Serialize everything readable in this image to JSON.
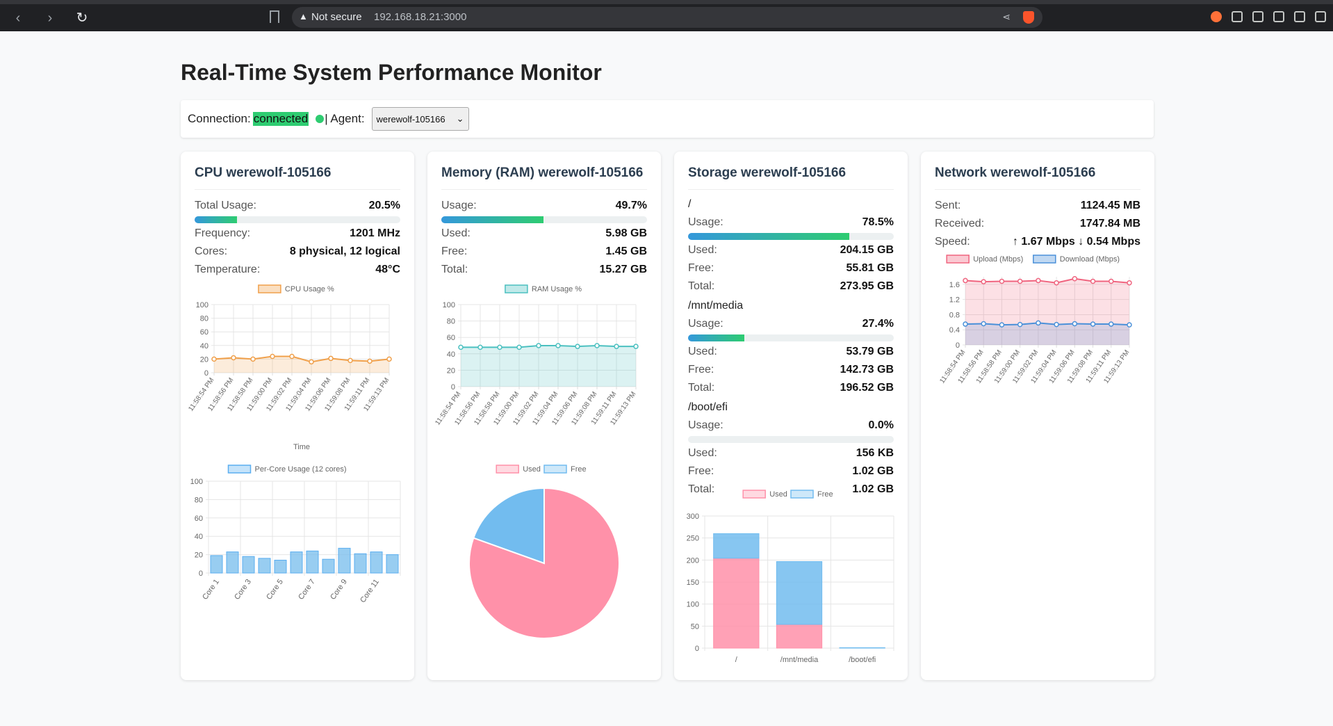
{
  "browser": {
    "security_label": "Not secure",
    "url": "192.168.18.21:3000"
  },
  "page": {
    "title": "Real-Time System Performance Monitor",
    "connection_label": "Connection:",
    "connection_state": "connected",
    "agent_label": "| Agent:",
    "agent_selected": "werewolf-105166",
    "status_color": "#2ecc71"
  },
  "cpu": {
    "title": "CPU werewolf-105166",
    "total_usage_label": "Total Usage:",
    "total_usage": "20.5%",
    "total_usage_value": 20.5,
    "frequency_label": "Frequency:",
    "frequency": "1201 MHz",
    "cores_label": "Cores:",
    "cores": "8 physical, 12 logical",
    "temperature_label": "Temperature:",
    "temperature": "48°C"
  },
  "memory": {
    "title": "Memory (RAM) werewolf-105166",
    "usage_label": "Usage:",
    "usage": "49.7%",
    "usage_value": 49.7,
    "used_label": "Used:",
    "used": "5.98 GB",
    "free_label": "Free:",
    "free": "1.45 GB",
    "total_label": "Total:",
    "total": "15.27 GB"
  },
  "storage": {
    "title": "Storage werewolf-105166",
    "mounts": [
      {
        "name": "/",
        "usage_label": "Usage:",
        "usage": "78.5%",
        "usage_value": 78.5,
        "used_label": "Used:",
        "used": "204.15 GB",
        "free_label": "Free:",
        "free": "55.81 GB",
        "total_label": "Total:",
        "total": "273.95 GB"
      },
      {
        "name": "/mnt/media",
        "usage_label": "Usage:",
        "usage": "27.4%",
        "usage_value": 27.4,
        "used_label": "Used:",
        "used": "53.79 GB",
        "free_label": "Free:",
        "free": "142.73 GB",
        "total_label": "Total:",
        "total": "196.52 GB"
      },
      {
        "name": "/boot/efi",
        "usage_label": "Usage:",
        "usage": "0.0%",
        "usage_value": 0.0,
        "used_label": "Used:",
        "used": "156 KB",
        "free_label": "Free:",
        "free": "1.02 GB",
        "total_label": "Total:",
        "total": "1.02 GB"
      }
    ]
  },
  "network": {
    "title": "Network werewolf-105166",
    "sent_label": "Sent:",
    "sent": "1124.45 MB",
    "received_label": "Received:",
    "received": "1747.84 MB",
    "speed_label": "Speed:",
    "speed": "↑ 1.67 Mbps ↓ 0.54 Mbps"
  },
  "chart_data": [
    {
      "id": "cpu_line",
      "type": "line",
      "legend": "CPU Usage %",
      "xlabel": "Time",
      "x": [
        "11:58:54 PM",
        "11:58:56 PM",
        "11:58:58 PM",
        "11:59:00 PM",
        "11:59:02 PM",
        "11:59:04 PM",
        "11:59:06 PM",
        "11:59:08 PM",
        "11:59:11 PM",
        "11:59:13 PM"
      ],
      "values": [
        20,
        22,
        20,
        24,
        24,
        16,
        21,
        18,
        17,
        20
      ],
      "ylim": [
        0,
        100
      ],
      "yticks": [
        0,
        20,
        40,
        60,
        80,
        100
      ],
      "color": "#f0a04b"
    },
    {
      "id": "cpu_cores",
      "type": "bar",
      "legend": "Per-Core Usage (12 cores)",
      "categories": [
        "Core 1",
        "Core 2",
        "Core 3",
        "Core 4",
        "Core 5",
        "Core 6",
        "Core 7",
        "Core 8",
        "Core 9",
        "Core 10",
        "Core 11",
        "Core 12"
      ],
      "shown_tick_labels": [
        "Core 1",
        "Core 3",
        "Core 5",
        "Core 7",
        "Core 9",
        "Core 11"
      ],
      "values": [
        19,
        23,
        18,
        16,
        14,
        23,
        24,
        15,
        27,
        21,
        23,
        20
      ],
      "ylim": [
        0,
        100
      ],
      "yticks": [
        0,
        20,
        40,
        60,
        80,
        100
      ],
      "color": "#7ec0ee"
    },
    {
      "id": "ram_line",
      "type": "area",
      "legend": "RAM Usage %",
      "x": [
        "11:58:54 PM",
        "11:58:56 PM",
        "11:58:58 PM",
        "11:59:00 PM",
        "11:59:02 PM",
        "11:59:04 PM",
        "11:59:06 PM",
        "11:59:08 PM",
        "11:59:11 PM",
        "11:59:13 PM"
      ],
      "values": [
        48,
        48,
        48,
        48,
        50,
        50,
        49,
        50,
        49,
        49
      ],
      "ylim": [
        0,
        100
      ],
      "yticks": [
        0,
        20,
        40,
        60,
        80,
        100
      ],
      "color": "#4bc0c0"
    },
    {
      "id": "ram_pie",
      "type": "pie",
      "labels": [
        "Used",
        "Free"
      ],
      "values": [
        5.98,
        1.45
      ],
      "colors": [
        "#ff91a9",
        "#72bcef"
      ]
    },
    {
      "id": "storage_bar",
      "type": "bar",
      "stacked": true,
      "categories": [
        "/",
        "/mnt/media",
        "/boot/efi"
      ],
      "series": [
        {
          "name": "Used",
          "values": [
            204.15,
            53.79,
            0.0
          ],
          "color": "#ff91a9"
        },
        {
          "name": "Free",
          "values": [
            55.81,
            142.73,
            1.02
          ],
          "color": "#72bcef"
        }
      ],
      "ylim": [
        0,
        300
      ],
      "yticks": [
        0,
        50,
        100,
        150,
        200,
        250,
        300
      ]
    },
    {
      "id": "net_line",
      "type": "area",
      "x": [
        "11:58:54 PM",
        "11:58:56 PM",
        "11:58:58 PM",
        "11:59:00 PM",
        "11:59:02 PM",
        "11:59:04 PM",
        "11:59:06 PM",
        "11:59:08 PM",
        "11:59:11 PM",
        "11:59:13 PM"
      ],
      "series": [
        {
          "name": "Upload (Mbps)",
          "values": [
            1.7,
            1.67,
            1.68,
            1.68,
            1.7,
            1.64,
            1.75,
            1.68,
            1.68,
            1.64
          ],
          "color": "#f0647f"
        },
        {
          "name": "Download (Mbps)",
          "values": [
            0.55,
            0.56,
            0.53,
            0.54,
            0.58,
            0.54,
            0.56,
            0.55,
            0.55,
            0.53
          ],
          "color": "#4a90d9"
        }
      ],
      "ylim": [
        0,
        1.8
      ],
      "yticks": [
        0,
        0.4,
        0.8,
        1.2,
        1.6
      ]
    }
  ]
}
